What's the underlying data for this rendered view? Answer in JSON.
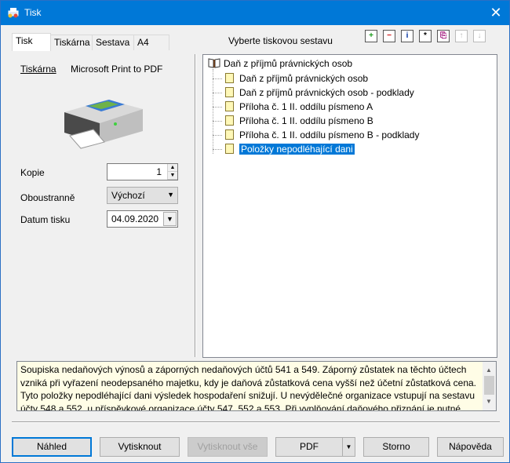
{
  "window": {
    "title": "Tisk"
  },
  "tabs": [
    "Tisk",
    "Tiskárna",
    "Sestava",
    "A4"
  ],
  "printer": {
    "label": "Tiskárna",
    "name": "Microsoft Print to PDF"
  },
  "copies": {
    "label": "Kopie",
    "value": "1"
  },
  "duplex": {
    "label": "Oboustranně",
    "value": "Výchozí"
  },
  "print_date": {
    "label": "Datum tisku",
    "value": "04.09.2020"
  },
  "tree": {
    "heading": "Vyberte tiskovou sestavu",
    "root": "Daň z příjmů právnických osob",
    "items": [
      "Daň z příjmů právnických osob",
      "Daň z příjmů právnických osob - podklady",
      "Příloha č. 1 II. oddílu písmeno A",
      "Příloha č. 1 II. oddílu písmeno B",
      "Příloha č. 1 II. oddílu písmeno B - podklady",
      "Položky nepodléhající dani"
    ],
    "selected_index": 5,
    "toolbar_icons": [
      "add-icon",
      "remove-icon",
      "info-icon",
      "asterisk-icon",
      "copy-icon",
      "move-up-icon",
      "move-down-icon"
    ]
  },
  "description": "Soupiska nedaňových výnosů a záporných nedaňových účtů 541 a 549. Záporný zůstatek na těchto účtech vzniká při vyřazení neodepsaného majetku, kdy je daňová zůstatková cena vyšší než účetní zůstatková cena. Tyto položky nepodléhající dani výsledek hospodaření snižují. U nevýdělečné organizace vstupují na sestavu účty 548 a 552, u příspěvkové organizace účty 547, 552 a 553. Při vyplňování daňového přiznání je nutné zůstatky účtů",
  "buttons": {
    "preview": "Náhled",
    "print": "Vytisknout",
    "print_all": "Vytisknout vše",
    "pdf": "PDF",
    "cancel": "Storno",
    "help": "Nápověda"
  },
  "colors": {
    "titlebar": "#0078d7",
    "selection": "#0078d7",
    "description_bg": "#fffde6"
  }
}
